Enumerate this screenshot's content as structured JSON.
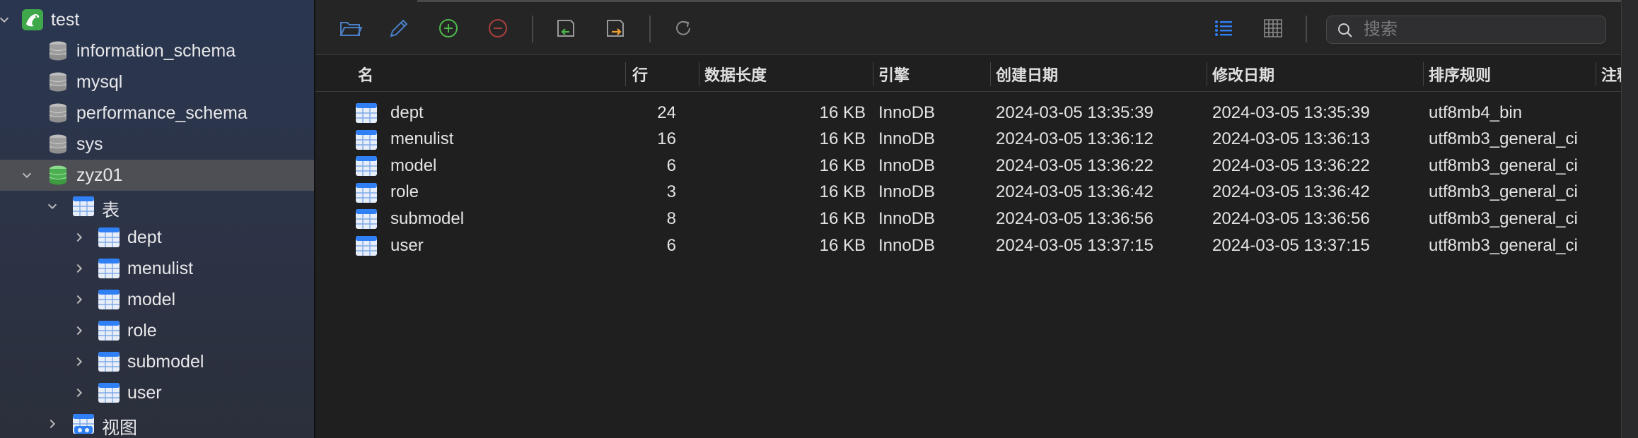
{
  "sidebar": {
    "connection": {
      "name": "test"
    },
    "databases": [
      {
        "name": "information_schema"
      },
      {
        "name": "mysql"
      },
      {
        "name": "performance_schema"
      },
      {
        "name": "sys"
      },
      {
        "name": "zyz01",
        "expanded": true,
        "selected": true
      }
    ],
    "tables_group": {
      "label": "表"
    },
    "tables": [
      {
        "name": "dept"
      },
      {
        "name": "menulist"
      },
      {
        "name": "model"
      },
      {
        "name": "role"
      },
      {
        "name": "submodel"
      },
      {
        "name": "user"
      }
    ],
    "views_group": {
      "label": "视图"
    }
  },
  "toolbar": {
    "icons": [
      "folder-open-icon",
      "pencil-icon",
      "plus-circle-icon",
      "minus-circle-icon",
      "import-icon",
      "export-icon",
      "refresh-icon",
      "list-view-icon",
      "grid-view-icon"
    ],
    "search_placeholder": "搜索"
  },
  "table": {
    "columns": [
      "名",
      "行",
      "数据长度",
      "引擎",
      "创建日期",
      "修改日期",
      "排序规则",
      "注释"
    ],
    "rows": [
      {
        "name": "dept",
        "rows": "24",
        "data_length": "16 KB",
        "engine": "InnoDB",
        "created": "2024-03-05 13:35:39",
        "modified": "2024-03-05 13:35:39",
        "collation": "utf8mb4_bin"
      },
      {
        "name": "menulist",
        "rows": "16",
        "data_length": "16 KB",
        "engine": "InnoDB",
        "created": "2024-03-05 13:36:12",
        "modified": "2024-03-05 13:36:13",
        "collation": "utf8mb3_general_ci"
      },
      {
        "name": "model",
        "rows": "6",
        "data_length": "16 KB",
        "engine": "InnoDB",
        "created": "2024-03-05 13:36:22",
        "modified": "2024-03-05 13:36:22",
        "collation": "utf8mb3_general_ci"
      },
      {
        "name": "role",
        "rows": "3",
        "data_length": "16 KB",
        "engine": "InnoDB",
        "created": "2024-03-05 13:36:42",
        "modified": "2024-03-05 13:36:42",
        "collation": "utf8mb3_general_ci"
      },
      {
        "name": "submodel",
        "rows": "8",
        "data_length": "16 KB",
        "engine": "InnoDB",
        "created": "2024-03-05 13:36:56",
        "modified": "2024-03-05 13:36:56",
        "collation": "utf8mb3_general_ci"
      },
      {
        "name": "user",
        "rows": "6",
        "data_length": "16 KB",
        "engine": "InnoDB",
        "created": "2024-03-05 13:37:15",
        "modified": "2024-03-05 13:37:15",
        "collation": "utf8mb3_general_ci"
      }
    ]
  },
  "colors": {
    "accent_blue": "#2f7ff5",
    "add_green": "#4cb84a",
    "remove_red": "#d9534f",
    "export_orange": "#f0a030",
    "db_active_green": "#4caf50"
  }
}
